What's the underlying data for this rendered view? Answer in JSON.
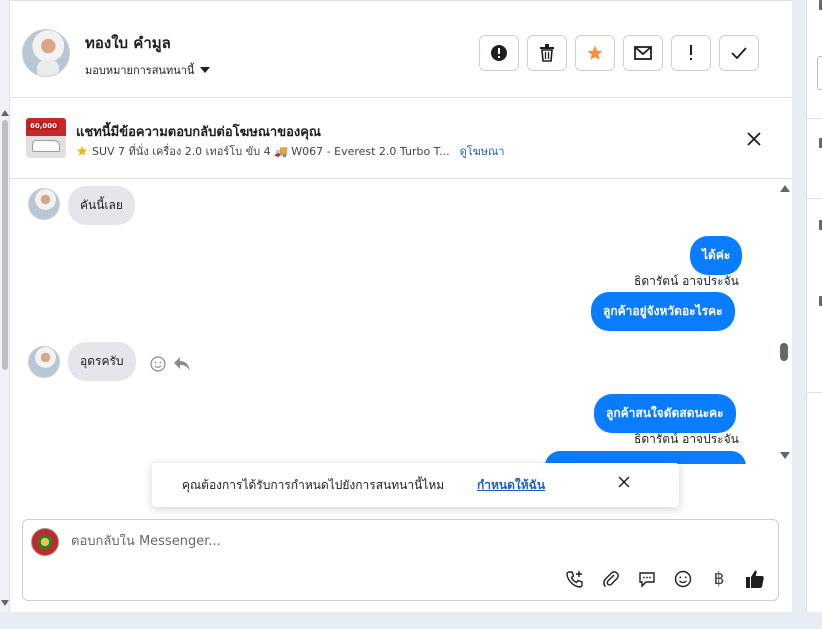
{
  "header": {
    "contact_name": "ทองใบ คำมูล",
    "assign_label": "มอบหมายการสนทนานี้",
    "actions": [
      {
        "icon": "alert-circle-icon",
        "name": "report-button"
      },
      {
        "icon": "trash-icon",
        "name": "delete-button"
      },
      {
        "icon": "star-icon",
        "name": "star-button"
      },
      {
        "icon": "envelope-icon",
        "name": "mark-unread-button"
      },
      {
        "icon": "exclamation-icon",
        "name": "follow-up-button"
      },
      {
        "icon": "check-icon",
        "name": "done-button"
      }
    ]
  },
  "ad_banner": {
    "title": "แชทนี้มีข้อความตอบกลับต่อโฆษณาของคุณ",
    "thumb_badge": "60,000",
    "subtitle": "SUV 7 ที่นั่ง เครื่อง 2.0 เทอร์โบ ขับ 4 🚚 W067 - Everest 2.0 Turbo T...",
    "link": "ดูโฆษณา"
  },
  "messages": [
    {
      "direction": "in",
      "text": "คันนี้เลย"
    },
    {
      "direction": "out",
      "text": "ได้ค่ะ"
    },
    {
      "sender": "ธิดารัตน์ อาจประจัน"
    },
    {
      "direction": "out",
      "text": "ลูกค้าอยู่จังหวัดอะไรคะ"
    },
    {
      "direction": "in",
      "text": "อุดรครับ"
    },
    {
      "direction": "out",
      "text": "ลูกค้าสนใจดัดสดนะคะ"
    },
    {
      "sender": "ธิดารัตน์ อาจประจัน"
    }
  ],
  "toast": {
    "text": "คุณต้องการได้รับการกำหนดไปยังการสนทนานี้ไหม",
    "link": "กำหนดให้ฉัน"
  },
  "composer": {
    "placeholder": "ตอบกลับใน Messenger...",
    "icons": [
      "phone-add-icon",
      "paperclip-icon",
      "chat-bubble-icon",
      "smiley-icon",
      "baht-icon",
      "thumbs-up-icon"
    ]
  },
  "colors": {
    "accent": "#0a7cff",
    "link": "#1d5fbf",
    "incoming_bubble": "#e4e6eb",
    "star": "#f7923a"
  }
}
